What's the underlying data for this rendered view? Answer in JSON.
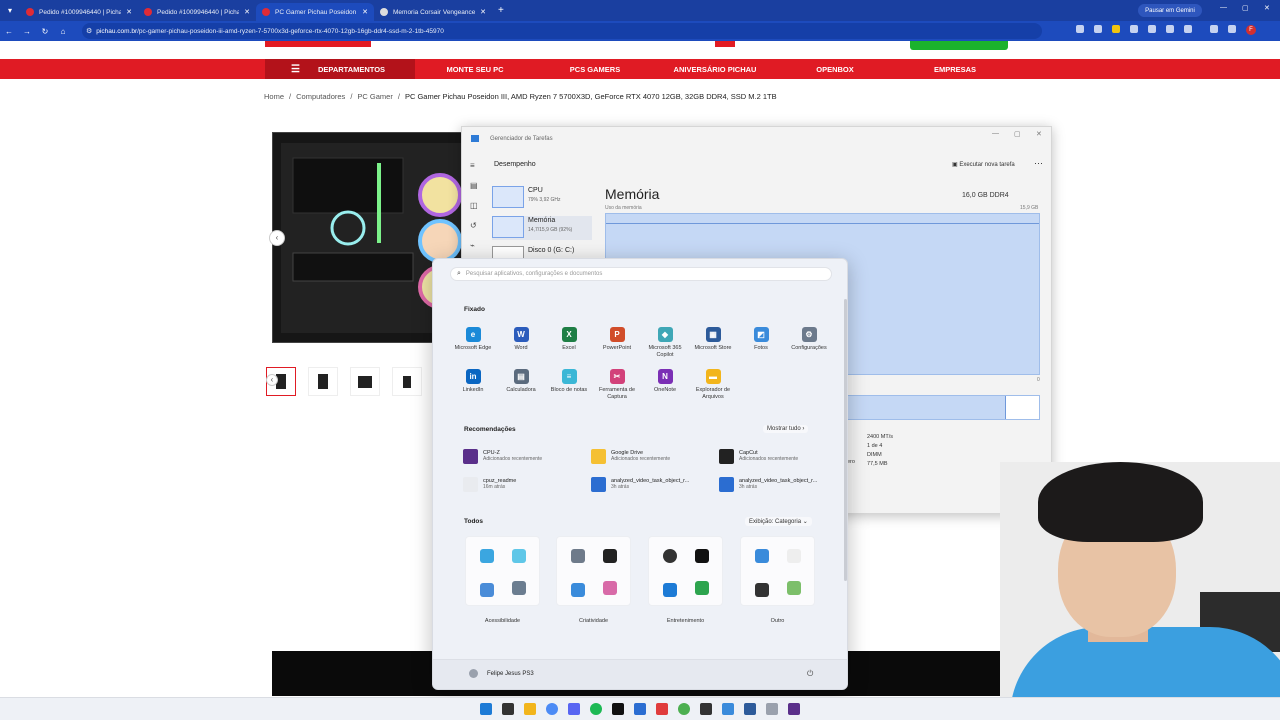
{
  "browser": {
    "tabs": [
      {
        "title": "Pedido #1009946440 | Pichau",
        "active": false
      },
      {
        "title": "Pedido #1009946440 | Pichau",
        "active": false
      },
      {
        "title": "PC Gamer Pichau Poseidon III, A",
        "active": true
      },
      {
        "title": "Memoria Corsair Vengeance R",
        "active": false
      }
    ],
    "new_tab": "+",
    "profile_button": "Pausar em Gemini",
    "url_prefix": "pichau.com.br",
    "url_path": "/pc-gamer-pichau-poseidon-iii-amd-ryzen-7-5700x3d-geforce-rtx-4070-12gb-16gb-ddr4-ssd-m-2-1tb-45970",
    "profile_initial": "F"
  },
  "site": {
    "menu": {
      "departments": "DEPARTAMENTOS",
      "items": [
        "MONTE SEU PC",
        "PCS GAMERS",
        "ANIVERSÁRIO PICHAU",
        "OPENBOX",
        "EMPRESAS"
      ]
    },
    "breadcrumb": [
      "Home",
      "Computadores",
      "PC Gamer",
      "PC Gamer Pichau Poseidon III, AMD Ryzen 7 5700X3D, GeForce RTX 4070 12GB, 32GB DDR4, SSD M.2 1TB"
    ]
  },
  "task_manager": {
    "title": "Gerenciador de Tarefas",
    "section": "Desempenho",
    "run_task": "Executar nova tarefa",
    "items": [
      {
        "name": "CPU",
        "sub": "79%  3,92 GHz"
      },
      {
        "name": "Memória",
        "sub": "14,7/15,9 GB (92%)"
      },
      {
        "name": "Disco 0 (G: C:)",
        "sub": ""
      }
    ],
    "heading": "Memória",
    "capacity": "16,0 GB DDR4",
    "usage_label": "Uso da memória",
    "usage_max": "15,9 GB",
    "zero": "0",
    "memory_usage_fraction": 0.92,
    "stats": [
      "2400 MT/s",
      "1 de 4",
      "DIMM",
      "77,5 MB"
    ],
    "stats_label": "ero"
  },
  "start_menu": {
    "search_placeholder": "Pesquisar aplicativos, configurações e documentos",
    "pinned_title": "Fixado",
    "pinned": [
      {
        "label": "Microsoft Edge",
        "icon": "edge-icon",
        "color": "#1b8ad8",
        "glyph": "e"
      },
      {
        "label": "Word",
        "icon": "word-icon",
        "color": "#2b5cbc",
        "glyph": "W"
      },
      {
        "label": "Excel",
        "icon": "excel-icon",
        "color": "#1e7e45",
        "glyph": "X"
      },
      {
        "label": "PowerPoint",
        "icon": "powerpoint-icon",
        "color": "#d14d2a",
        "glyph": "P"
      },
      {
        "label": "Microsoft 365 Copilot",
        "icon": "copilot-icon",
        "color": "#3fa7b6",
        "glyph": "◆"
      },
      {
        "label": "Microsoft Store",
        "icon": "store-icon",
        "color": "#2d5b9a",
        "glyph": "▦"
      },
      {
        "label": "Fotos",
        "icon": "photos-icon",
        "color": "#3a8bdb",
        "glyph": "◩"
      },
      {
        "label": "Configurações",
        "icon": "settings-icon",
        "color": "#6c7a8c",
        "glyph": "⚙"
      },
      {
        "label": "LinkedIn",
        "icon": "linkedin-icon",
        "color": "#0a66c2",
        "glyph": "in"
      },
      {
        "label": "Calculadora",
        "icon": "calculator-icon",
        "color": "#5b6b7e",
        "glyph": "▤"
      },
      {
        "label": "Bloco de notas",
        "icon": "notepad-icon",
        "color": "#3bb7d6",
        "glyph": "≡"
      },
      {
        "label": "Ferramenta de Captura",
        "icon": "snipping-icon",
        "color": "#d2417a",
        "glyph": "✂"
      },
      {
        "label": "OneNote",
        "icon": "onenote-icon",
        "color": "#7b2fb5",
        "glyph": "N"
      },
      {
        "label": "Explorador de Arquivos",
        "icon": "folder-icon",
        "color": "#f2b51c",
        "glyph": "▬"
      }
    ],
    "recommended_title": "Recomendações",
    "show_all": "Mostrar tudo",
    "recommended": [
      {
        "name": "CPU-Z",
        "sub": "Adicionados recentemente",
        "icon": "cpuz-icon",
        "color": "#5a2f8a"
      },
      {
        "name": "Google Drive",
        "sub": "Adicionados recentemente",
        "icon": "drive-icon",
        "color": "#f5c033"
      },
      {
        "name": "CapCut",
        "sub": "Adicionados recentemente",
        "icon": "capcut-icon",
        "color": "#222222"
      },
      {
        "name": "cpuz_readme",
        "sub": "16m atrás",
        "icon": "file-icon",
        "color": "#e9ebef"
      },
      {
        "name": "analyzed_video_task_object_r...",
        "sub": "3h atrás",
        "icon": "file-icon",
        "color": "#2b6dd1"
      },
      {
        "name": "analyzed_video_task_object_r...",
        "sub": "3h atrás",
        "icon": "file-icon",
        "color": "#2b6dd1"
      }
    ],
    "all_title": "Todos",
    "view": "Exibição: Categoria",
    "categories": [
      "Acessibilidade",
      "Criatividade",
      "Entretenimento",
      "Outro"
    ],
    "user": "Felipe Jesus PS3"
  }
}
